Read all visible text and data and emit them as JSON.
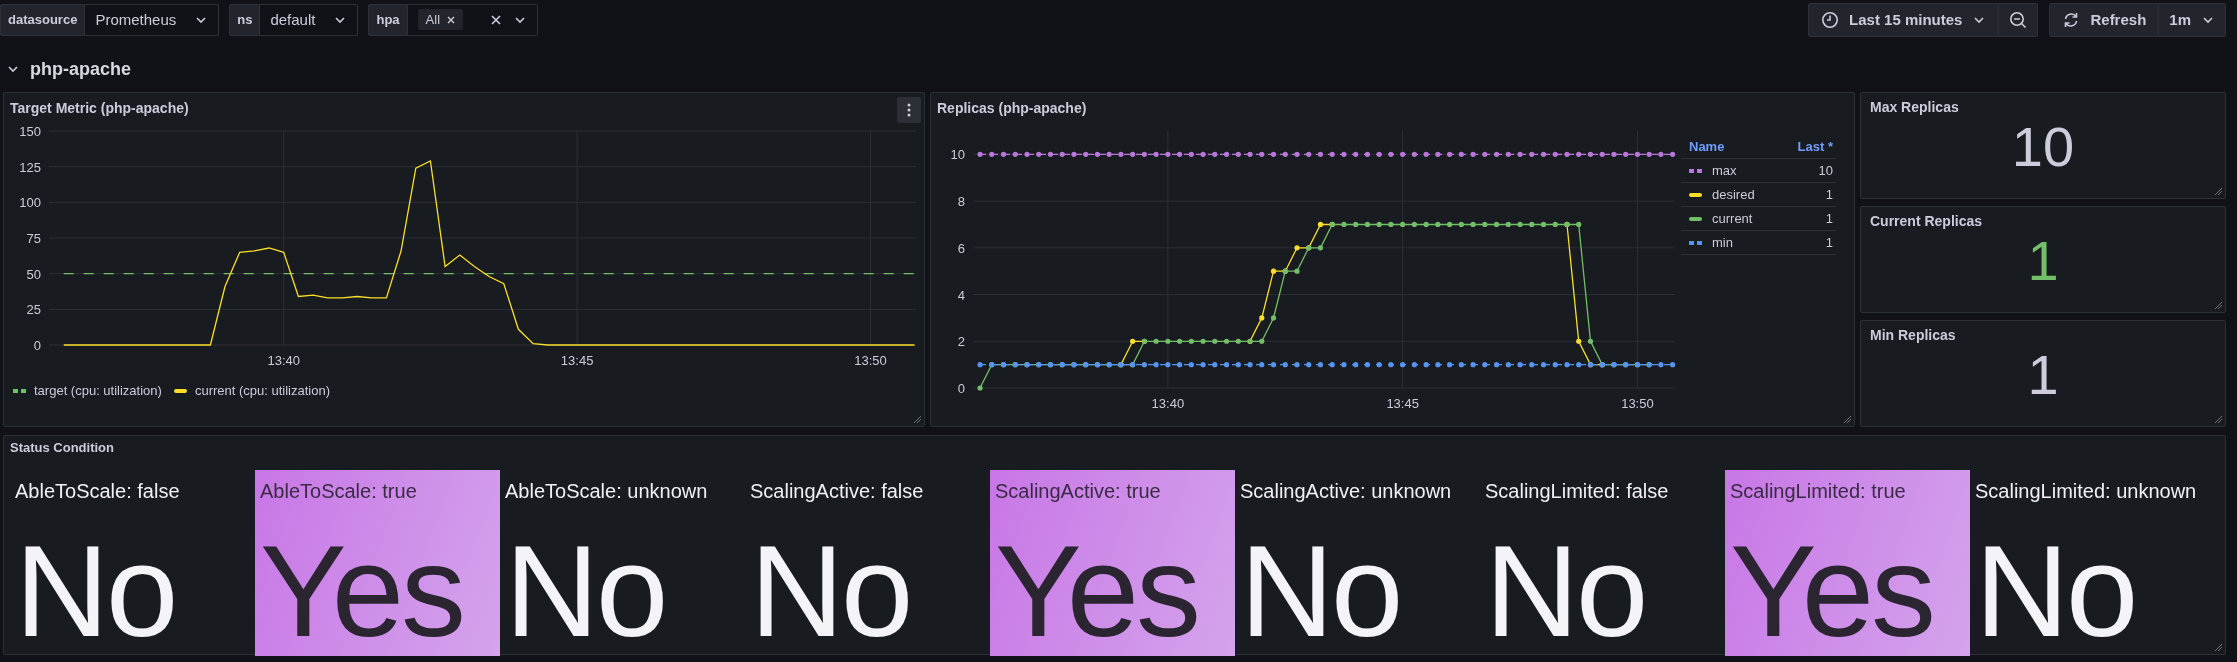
{
  "toolbar": {
    "variables": [
      {
        "label": "datasource",
        "kind": "select",
        "value": "Prometheus"
      },
      {
        "label": "ns",
        "kind": "select",
        "value": "default"
      },
      {
        "label": "hpa",
        "kind": "multi",
        "tags": [
          "All"
        ]
      }
    ],
    "time_range": "Last 15 minutes",
    "refresh": "Refresh",
    "refresh_interval": "1m"
  },
  "row": {
    "title": "php-apache",
    "expanded": true
  },
  "target_metric": {
    "title": "Target Metric (php-apache)",
    "chart_data": {
      "type": "line",
      "grid": true,
      "ylim": [
        0,
        150
      ],
      "yticks": [
        0,
        25,
        50,
        75,
        100,
        125,
        150
      ],
      "categories": [
        null,
        null,
        null,
        null,
        null,
        null,
        null,
        null,
        null,
        null,
        null,
        null,
        null,
        null,
        null,
        "13:40",
        null,
        null,
        null,
        null,
        null,
        null,
        null,
        null,
        null,
        null,
        null,
        null,
        null,
        null,
        null,
        null,
        null,
        null,
        null,
        "13:45",
        null,
        null,
        null,
        null,
        null,
        null,
        null,
        null,
        null,
        null,
        null,
        null,
        null,
        null,
        null,
        null,
        null,
        null,
        null,
        "13:50",
        null,
        null,
        null
      ],
      "series": [
        {
          "name": "target (cpu: utilization)",
          "color": "#73bf69",
          "line_style": "dashed",
          "values": [
            50,
            50,
            50,
            50,
            50,
            50,
            50,
            50,
            50,
            50,
            50,
            50,
            50,
            50,
            50,
            50,
            50,
            50,
            50,
            50,
            50,
            50,
            50,
            50,
            50,
            50,
            50,
            50,
            50,
            50,
            50,
            50,
            50,
            50,
            50,
            50,
            50,
            50,
            50,
            50,
            50,
            50,
            50,
            50,
            50,
            50,
            50,
            50,
            50,
            50,
            50,
            50,
            50,
            50,
            50,
            50,
            50,
            50,
            50
          ]
        },
        {
          "name": "current (cpu: utilization)",
          "color": "#fade2a",
          "line_style": "solid",
          "values": [
            0,
            0,
            0,
            0,
            0,
            0,
            0,
            0,
            0,
            0,
            0,
            41,
            65,
            66,
            68,
            65,
            34,
            35,
            33,
            33,
            34,
            33,
            33,
            66,
            124,
            129,
            55,
            63,
            55,
            48,
            43,
            11,
            1,
            0,
            0,
            0,
            0,
            0,
            0,
            0,
            0,
            0,
            0,
            0,
            0,
            0,
            0,
            0,
            0,
            0,
            0,
            0,
            0,
            0,
            0,
            0,
            0,
            0,
            0
          ]
        }
      ]
    }
  },
  "replicas": {
    "title": "Replicas (php-apache)",
    "points_visible": true,
    "legend_columns": [
      "Name",
      "Last *"
    ],
    "legend_last": [
      "10",
      "1",
      "1",
      "1"
    ],
    "chart_data": {
      "type": "line",
      "grid": true,
      "ylim": [
        0,
        11
      ],
      "yticks": [
        0,
        2,
        4,
        6,
        8,
        10
      ],
      "categories": [
        null,
        null,
        null,
        null,
        null,
        null,
        null,
        null,
        null,
        null,
        null,
        null,
        null,
        null,
        null,
        null,
        "13:40",
        null,
        null,
        null,
        null,
        null,
        null,
        null,
        null,
        null,
        null,
        null,
        null,
        null,
        null,
        null,
        null,
        null,
        null,
        null,
        "13:45",
        null,
        null,
        null,
        null,
        null,
        null,
        null,
        null,
        null,
        null,
        null,
        null,
        null,
        null,
        null,
        null,
        null,
        null,
        null,
        "13:50",
        null,
        null,
        null
      ],
      "series": [
        {
          "name": "max",
          "color": "#b877d9",
          "line_style": "dashed",
          "values": [
            10,
            10,
            10,
            10,
            10,
            10,
            10,
            10,
            10,
            10,
            10,
            10,
            10,
            10,
            10,
            10,
            10,
            10,
            10,
            10,
            10,
            10,
            10,
            10,
            10,
            10,
            10,
            10,
            10,
            10,
            10,
            10,
            10,
            10,
            10,
            10,
            10,
            10,
            10,
            10,
            10,
            10,
            10,
            10,
            10,
            10,
            10,
            10,
            10,
            10,
            10,
            10,
            10,
            10,
            10,
            10,
            10,
            10,
            10,
            10
          ]
        },
        {
          "name": "desired",
          "color": "#fade2a",
          "line_style": "solid",
          "values": [
            null,
            null,
            null,
            null,
            null,
            null,
            null,
            null,
            null,
            null,
            null,
            null,
            1,
            2,
            2,
            null,
            null,
            null,
            null,
            null,
            null,
            null,
            null,
            2,
            3,
            5,
            5,
            6,
            6,
            7,
            7,
            null,
            null,
            null,
            null,
            null,
            null,
            null,
            null,
            null,
            null,
            null,
            null,
            null,
            null,
            null,
            null,
            null,
            null,
            null,
            7,
            2,
            1,
            1,
            null,
            null,
            null,
            null,
            null,
            null
          ]
        },
        {
          "name": "current",
          "color": "#73bf69",
          "line_style": "solid",
          "values": [
            0,
            1,
            1,
            1,
            1,
            1,
            1,
            1,
            1,
            1,
            1,
            1,
            1,
            1,
            2,
            2,
            2,
            2,
            2,
            2,
            2,
            2,
            2,
            2,
            2,
            3,
            5,
            5,
            6,
            6,
            7,
            7,
            7,
            7,
            7,
            7,
            7,
            7,
            7,
            7,
            7,
            7,
            7,
            7,
            7,
            7,
            7,
            7,
            7,
            7,
            7,
            7,
            2,
            1,
            1,
            1,
            1,
            1,
            null,
            null
          ]
        },
        {
          "name": "min",
          "color": "#5794f2",
          "line_style": "dashed",
          "values": [
            1,
            1,
            1,
            1,
            1,
            1,
            1,
            1,
            1,
            1,
            1,
            1,
            1,
            1,
            1,
            1,
            1,
            1,
            1,
            1,
            1,
            1,
            1,
            1,
            1,
            1,
            1,
            1,
            1,
            1,
            1,
            1,
            1,
            1,
            1,
            1,
            1,
            1,
            1,
            1,
            1,
            1,
            1,
            1,
            1,
            1,
            1,
            1,
            1,
            1,
            1,
            1,
            1,
            1,
            1,
            1,
            1,
            1,
            1,
            1
          ]
        }
      ]
    }
  },
  "stats": [
    {
      "title": "Max Replicas",
      "value": "10",
      "color": "#ccccdc"
    },
    {
      "title": "Current Replicas",
      "value": "1",
      "color": "#73bf69"
    },
    {
      "title": "Min Replicas",
      "value": "1",
      "color": "#ccccdc"
    }
  ],
  "status_condition": {
    "title": "Status Condition",
    "tiles": [
      {
        "label": "AbleToScale: false",
        "value": "No",
        "highlighted": false
      },
      {
        "label": "AbleToScale: true",
        "value": "Yes",
        "highlighted": true
      },
      {
        "label": "AbleToScale: unknown",
        "value": "No",
        "highlighted": false
      },
      {
        "label": "ScalingActive: false",
        "value": "No",
        "highlighted": false
      },
      {
        "label": "ScalingActive: true",
        "value": "Yes",
        "highlighted": true
      },
      {
        "label": "ScalingActive: unknown",
        "value": "No",
        "highlighted": false
      },
      {
        "label": "ScalingLimited: false",
        "value": "No",
        "highlighted": false
      },
      {
        "label": "ScalingLimited: true",
        "value": "Yes",
        "highlighted": true
      },
      {
        "label": "ScalingLimited: unknown",
        "value": "No",
        "highlighted": false
      }
    ]
  }
}
